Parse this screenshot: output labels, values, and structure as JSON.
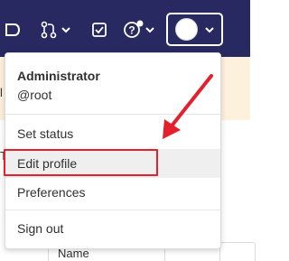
{
  "navbar": {
    "bg_color": "#292961",
    "icons": [
      "todo-icon",
      "merge-request-icon",
      "issues-icon",
      "help-icon"
    ],
    "user_button": {
      "avatar": "avatar-circle"
    }
  },
  "background": {
    "left_char_1": "l",
    "left_char_2": "T",
    "name_label": "Name"
  },
  "dropdown": {
    "user_name": "Administrator",
    "user_handle": "@root",
    "items": [
      {
        "label": "Set status"
      },
      {
        "label": "Edit profile"
      },
      {
        "label": "Preferences"
      },
      {
        "label": "Sign out"
      }
    ]
  },
  "annotation": {
    "highlight_color": "#e3202b",
    "highlighted_item": "Edit profile"
  }
}
